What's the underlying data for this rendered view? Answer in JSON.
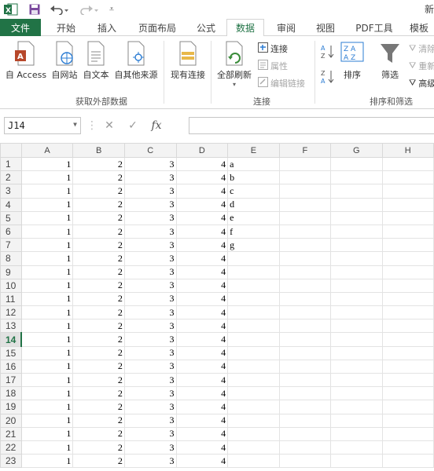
{
  "titlebar": {
    "excel_icon": "excel-logo",
    "save_icon": "save-icon",
    "undo_icon": "undo-icon",
    "redo_icon": "redo-icon",
    "title_fragment": "新"
  },
  "tabs": [
    {
      "label": "文件",
      "kind": "file"
    },
    {
      "label": "开始"
    },
    {
      "label": "插入"
    },
    {
      "label": "页面布局"
    },
    {
      "label": "公式"
    },
    {
      "label": "数据",
      "kind": "active"
    },
    {
      "label": "审阅"
    },
    {
      "label": "视图"
    },
    {
      "label": "PDF工具"
    },
    {
      "label": "模板"
    }
  ],
  "ribbon": {
    "get_external": {
      "access": "自 Access",
      "web": "自网站",
      "text": "自文本",
      "other": "自其他来源",
      "existing": "现有连接",
      "group_label": "获取外部数据"
    },
    "connections": {
      "refresh_all": "全部刷新",
      "connections": "连接",
      "properties": "属性",
      "edit_links": "编辑链接",
      "group_label": "连接"
    },
    "sort_filter": {
      "sort": "排序",
      "filter": "筛选",
      "clear": "清除",
      "reapply": "重新",
      "advanced": "高级",
      "group_label": "排序和筛选"
    }
  },
  "formula_bar": {
    "name_box": "J14",
    "fx": "fx",
    "formula": ""
  },
  "sheet": {
    "columns": [
      "A",
      "B",
      "C",
      "D",
      "E",
      "F",
      "G",
      "H"
    ],
    "selected_row": "14",
    "rows": [
      {
        "n": "1",
        "a": "1",
        "b": "2",
        "c": "3",
        "d": "4",
        "e": "a"
      },
      {
        "n": "2",
        "a": "1",
        "b": "2",
        "c": "3",
        "d": "4",
        "e": "b"
      },
      {
        "n": "3",
        "a": "1",
        "b": "2",
        "c": "3",
        "d": "4",
        "e": "c"
      },
      {
        "n": "4",
        "a": "1",
        "b": "2",
        "c": "3",
        "d": "4",
        "e": "d"
      },
      {
        "n": "5",
        "a": "1",
        "b": "2",
        "c": "3",
        "d": "4",
        "e": "e"
      },
      {
        "n": "6",
        "a": "1",
        "b": "2",
        "c": "3",
        "d": "4",
        "e": "f"
      },
      {
        "n": "7",
        "a": "1",
        "b": "2",
        "c": "3",
        "d": "4",
        "e": "g"
      },
      {
        "n": "8",
        "a": "1",
        "b": "2",
        "c": "3",
        "d": "4",
        "e": ""
      },
      {
        "n": "9",
        "a": "1",
        "b": "2",
        "c": "3",
        "d": "4",
        "e": ""
      },
      {
        "n": "10",
        "a": "1",
        "b": "2",
        "c": "3",
        "d": "4",
        "e": ""
      },
      {
        "n": "11",
        "a": "1",
        "b": "2",
        "c": "3",
        "d": "4",
        "e": ""
      },
      {
        "n": "12",
        "a": "1",
        "b": "2",
        "c": "3",
        "d": "4",
        "e": ""
      },
      {
        "n": "13",
        "a": "1",
        "b": "2",
        "c": "3",
        "d": "4",
        "e": ""
      },
      {
        "n": "14",
        "a": "1",
        "b": "2",
        "c": "3",
        "d": "4",
        "e": ""
      },
      {
        "n": "15",
        "a": "1",
        "b": "2",
        "c": "3",
        "d": "4",
        "e": ""
      },
      {
        "n": "16",
        "a": "1",
        "b": "2",
        "c": "3",
        "d": "4",
        "e": ""
      },
      {
        "n": "17",
        "a": "1",
        "b": "2",
        "c": "3",
        "d": "4",
        "e": ""
      },
      {
        "n": "18",
        "a": "1",
        "b": "2",
        "c": "3",
        "d": "4",
        "e": ""
      },
      {
        "n": "19",
        "a": "1",
        "b": "2",
        "c": "3",
        "d": "4",
        "e": ""
      },
      {
        "n": "20",
        "a": "1",
        "b": "2",
        "c": "3",
        "d": "4",
        "e": ""
      },
      {
        "n": "21",
        "a": "1",
        "b": "2",
        "c": "3",
        "d": "4",
        "e": ""
      },
      {
        "n": "22",
        "a": "1",
        "b": "2",
        "c": "3",
        "d": "4",
        "e": ""
      },
      {
        "n": "23",
        "a": "1",
        "b": "2",
        "c": "3",
        "d": "4",
        "e": ""
      }
    ]
  },
  "colors": {
    "excel_green": "#217346",
    "header_bg": "#f3f3f3"
  }
}
